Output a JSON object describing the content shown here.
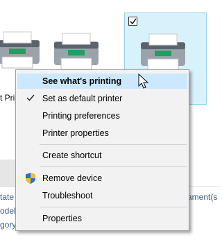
{
  "background": {
    "partial_label_left": "t Pri",
    "partial_left_column": [
      "tate",
      "odel",
      "gory"
    ],
    "partial_right_text": "ament(s"
  },
  "menu": {
    "items": [
      {
        "label": "See what's printing",
        "bold": true,
        "hover": true
      },
      {
        "label": "Set as default printer",
        "checked": true
      },
      {
        "label": "Printing preferences"
      },
      {
        "label": "Printer properties"
      },
      {
        "label": "Create shortcut"
      },
      {
        "label": "Remove device",
        "icon": "shield-icon"
      },
      {
        "label": "Troubleshoot"
      },
      {
        "label": "Properties"
      }
    ]
  },
  "colors": {
    "hover": "#cce8ff",
    "menu_bg": "#f2f2f2",
    "selected_tile": "#d8f2fb",
    "link_text": "#3a5b82"
  }
}
